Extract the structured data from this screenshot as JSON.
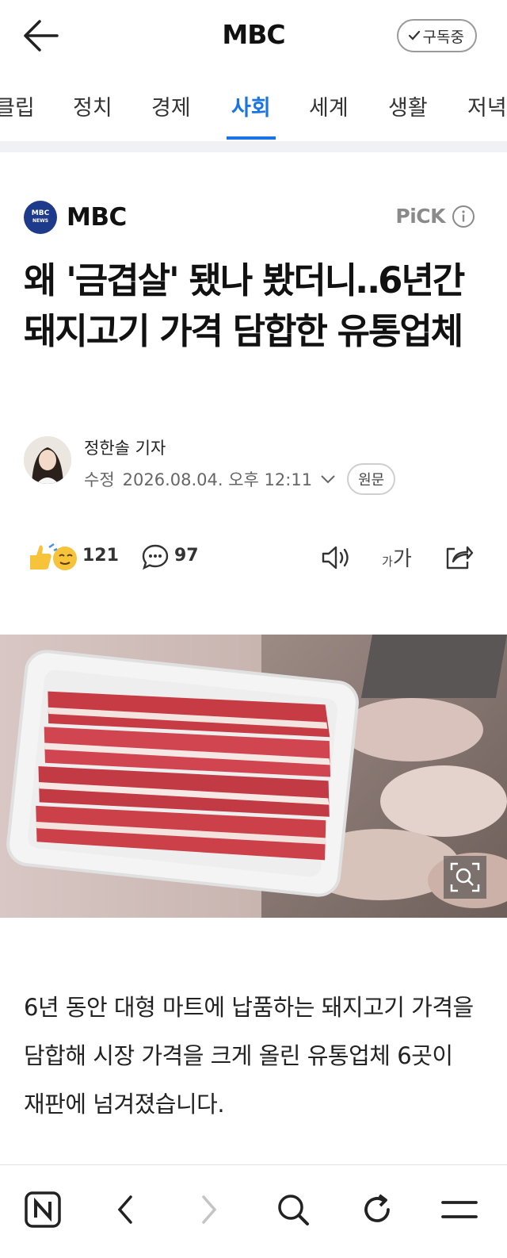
{
  "header": {
    "title": "MBC",
    "subscribe_label": "구독중"
  },
  "tabs": [
    {
      "label": "클립",
      "active": false
    },
    {
      "label": "정치",
      "active": false
    },
    {
      "label": "경제",
      "active": false
    },
    {
      "label": "사회",
      "active": true
    },
    {
      "label": "세계",
      "active": false
    },
    {
      "label": "생활",
      "active": false
    },
    {
      "label": "저녁",
      "active": false
    }
  ],
  "press": {
    "logo_top": "MBC",
    "logo_bottom": "NEWS",
    "name": "MBC",
    "pick_label": "PiCK"
  },
  "article": {
    "headline": "왜 '금겹살' 됐나 봤더니‥6년간 돼지고기 가격 담합한 유통업체",
    "author": "정한솔 기자",
    "meta_label": "수정",
    "timestamp": "2026.08.04. 오후 12:11",
    "origin_label": "원문",
    "likes": "121",
    "comments": "97",
    "font_size_small": "가",
    "font_size_large": "가",
    "body": "6년 동안 대형 마트에 납품하는 돼지고기 가격을 담합해 시장 가격을 크게 올린 유통업체 6곳이 재판에 넘겨졌습니다."
  },
  "colors": {
    "accent": "#1a74e6",
    "press_logo": "#1e3a8a"
  },
  "icons": {
    "back": "arrow-left-icon",
    "check": "check-icon",
    "info": "info-icon",
    "comment": "speech-bubble-icon",
    "tts": "speaker-icon",
    "share": "share-icon",
    "zoom": "zoom-icon",
    "naver": "naver-n-icon",
    "prev": "chevron-left-icon",
    "next": "chevron-right-icon",
    "search": "search-icon",
    "refresh": "refresh-icon",
    "menu": "menu-icon"
  }
}
